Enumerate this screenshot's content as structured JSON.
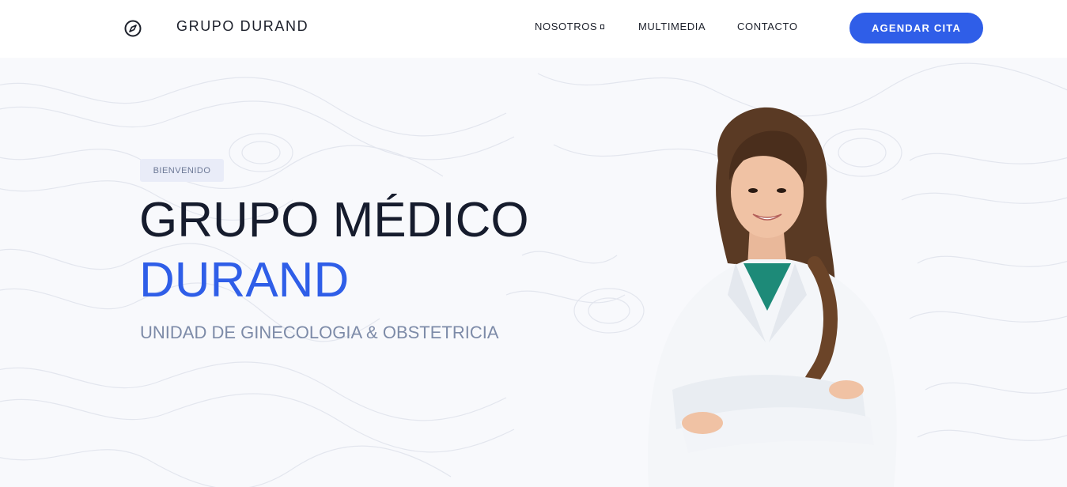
{
  "header": {
    "brand": "GRUPO DURAND",
    "brand_icon": "compass-icon",
    "nav": {
      "nosotros": "NOSOTROS",
      "multimedia": "MULTIMEDIA",
      "contacto": "CONTACTO"
    },
    "cta": "AGENDAR CITA"
  },
  "hero": {
    "badge": "BIENVENIDO",
    "title_line1": "GRUPO MÉDICO",
    "title_line2": "DURAND",
    "subtitle": "UNIDAD DE GINECOLOGIA & OBSTETRICIA",
    "image": "doctor-photo"
  },
  "colors": {
    "accent": "#2f5ee8",
    "title": "#161c2d",
    "subtitle": "#7d8ba8",
    "background": "#f8f9fc"
  }
}
